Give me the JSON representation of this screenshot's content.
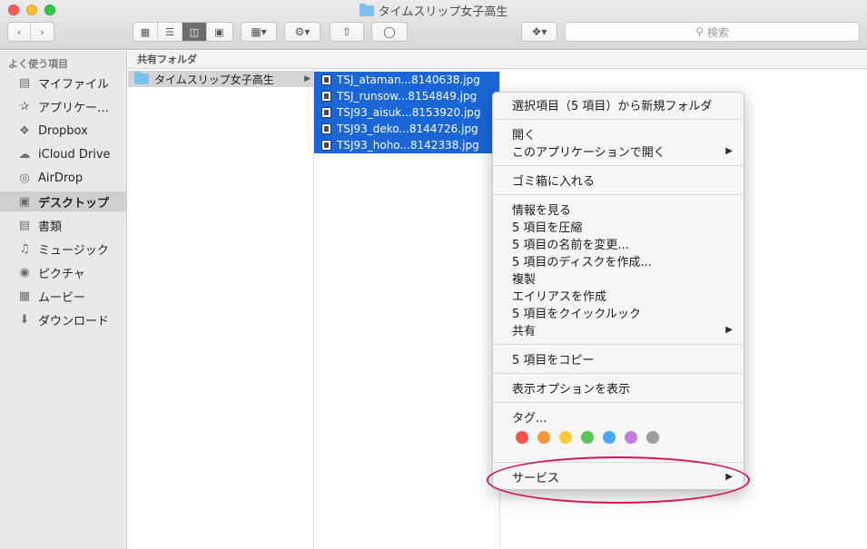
{
  "window": {
    "title": "タイムスリップ女子高生"
  },
  "toolbar": {
    "back_icon": "chevron-left-icon",
    "forward_icon": "chevron-right-icon",
    "search_placeholder": "検索"
  },
  "sidebar": {
    "heading": "よく使う項目",
    "items": [
      {
        "label": "マイファイル",
        "icon": "all-files-icon"
      },
      {
        "label": "アプリケー…",
        "icon": "applications-icon"
      },
      {
        "label": "Dropbox",
        "icon": "dropbox-icon"
      },
      {
        "label": "iCloud Drive",
        "icon": "cloud-icon"
      },
      {
        "label": "AirDrop",
        "icon": "airdrop-icon"
      },
      {
        "label": "デスクトップ",
        "icon": "desktop-icon"
      },
      {
        "label": "書類",
        "icon": "document-icon"
      },
      {
        "label": "ミュージック",
        "icon": "music-icon"
      },
      {
        "label": "ピクチャ",
        "icon": "camera-icon"
      },
      {
        "label": "ムービー",
        "icon": "film-icon"
      },
      {
        "label": "ダウンロード",
        "icon": "download-icon"
      }
    ]
  },
  "browser": {
    "header": "共有フォルダ",
    "folder": "タイムスリップ女子高生",
    "files": [
      "TSJ_ataman...8140638.jpg",
      "TSJ_runsow...8154849.jpg",
      "TSJ93_aisuk...8153920.jpg",
      "TSJ93_deko...8144726.jpg",
      "TSJ93_hoho...8142338.jpg"
    ]
  },
  "context_menu": {
    "new_folder": "選択項目（5 項目）から新規フォルダ",
    "open": "開く",
    "open_with": "このアプリケーションで開く",
    "trash": "ゴミ箱に入れる",
    "get_info": "情報を見る",
    "compress": "5 項目を圧縮",
    "rename": "5 項目の名前を変更...",
    "burn": "5 項目のディスクを作成...",
    "duplicate": "複製",
    "alias": "エイリアスを作成",
    "quicklook": "5 項目をクイックルック",
    "share": "共有",
    "copy": "5 項目をコピー",
    "view_options": "表示オプションを表示",
    "tags": "タグ...",
    "tag_colors": [
      "#f45353",
      "#f6973b",
      "#f5cc3c",
      "#5ac454",
      "#4aa9f0",
      "#c77ddc",
      "#9c9c9c"
    ],
    "services": "サービス"
  },
  "annotation": {
    "color": "#d6135d"
  }
}
